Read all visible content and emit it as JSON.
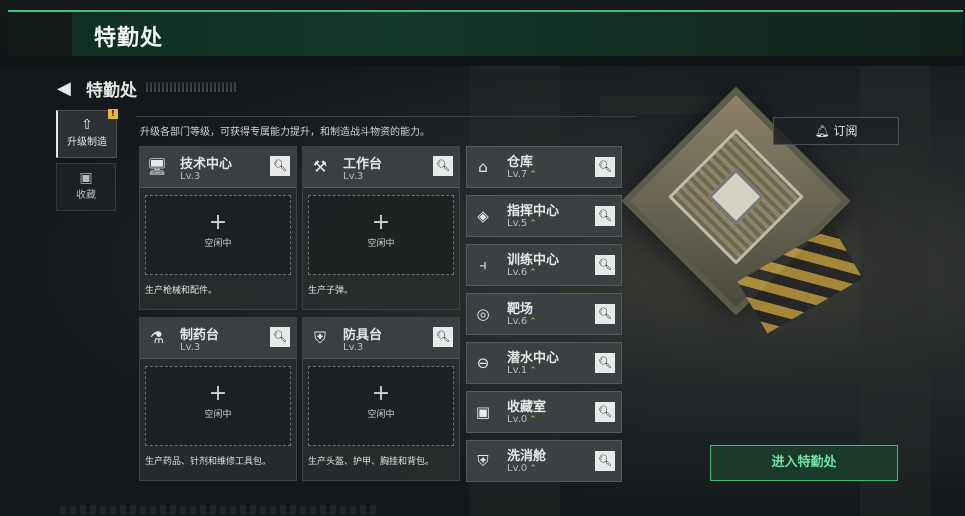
{
  "header": {
    "title": "特勤处"
  },
  "page": {
    "back_icon": "back-arrow-icon",
    "title": "特勤处"
  },
  "tabs": [
    {
      "label": "升级制造",
      "icon": "upgrade-icon",
      "active": true,
      "warning": "!"
    },
    {
      "label": "收藏",
      "icon": "collection-icon",
      "active": false
    }
  ],
  "description": "升级各部门等级，可获得专属能力提升，和制造战斗物资的能力。",
  "subscribe_label": "订阅",
  "workshops": [
    {
      "name": "技术中心",
      "level": "Lv.3",
      "icon": "monitor-icon",
      "slot": "空闲中",
      "desc": "生产枪械和配件。"
    },
    {
      "name": "工作台",
      "level": "Lv.3",
      "icon": "tools-icon",
      "slot": "空闲中",
      "desc": "生产子弹。"
    },
    {
      "name": "制药台",
      "level": "Lv.3",
      "icon": "microscope-icon",
      "slot": "空闲中",
      "desc": "生产药品、针剂和维修工具包。"
    },
    {
      "name": "防具台",
      "level": "Lv.3",
      "icon": "armor-icon",
      "slot": "空闲中",
      "desc": "生产头盔、护甲、胸挂和背包。"
    }
  ],
  "facilities": [
    {
      "name": "仓库",
      "level": "Lv.7",
      "icon": "warehouse-icon"
    },
    {
      "name": "指挥中心",
      "level": "Lv.5",
      "icon": "command-icon"
    },
    {
      "name": "训练中心",
      "level": "Lv.6",
      "icon": "dumbbell-icon"
    },
    {
      "name": "靶场",
      "level": "Lv.6",
      "icon": "target-icon"
    },
    {
      "name": "潜水中心",
      "level": "Lv.1",
      "icon": "diving-mask-icon"
    },
    {
      "name": "收藏室",
      "level": "Lv.0",
      "icon": "collection-room-icon"
    },
    {
      "name": "洗消舱",
      "level": "Lv.0",
      "icon": "decontamination-icon"
    }
  ],
  "enter_button": "进入特勤处",
  "colors": {
    "accent_green": "#41b87a",
    "upgrade_yellow": "#e5b935"
  }
}
